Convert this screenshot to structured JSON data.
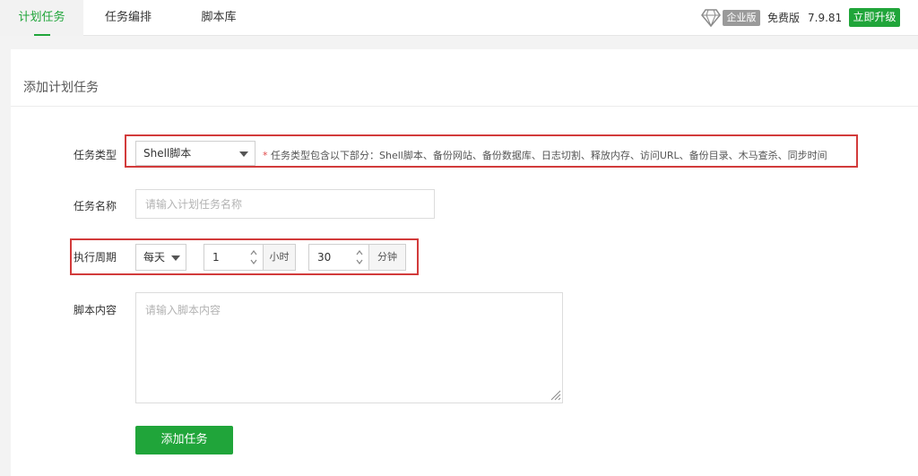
{
  "nav": {
    "tabs": [
      {
        "label": "计划任务",
        "active": true
      },
      {
        "label": "任务编排",
        "active": false
      },
      {
        "label": "脚本库",
        "active": false
      }
    ],
    "edition_badge": "企业版",
    "free_label": "免费版",
    "version": "7.9.81",
    "upgrade_label": "立即升级"
  },
  "panel": {
    "title": "添加计划任务"
  },
  "form": {
    "task_type": {
      "label": "任务类型",
      "selected": "Shell脚本",
      "hint_star": "*",
      "hint": "任务类型包含以下部分：Shell脚本、备份网站、备份数据库、日志切割、释放内存、访问URL、备份目录、木马查杀、同步时间"
    },
    "task_name": {
      "label": "任务名称",
      "placeholder": "请输入计划任务名称"
    },
    "period": {
      "label": "执行周期",
      "cycle": "每天",
      "hour_value": "1",
      "hour_unit": "小时",
      "minute_value": "30",
      "minute_unit": "分钟"
    },
    "script": {
      "label": "脚本内容",
      "placeholder": "请输入脚本内容"
    },
    "submit_label": "添加任务"
  },
  "colors": {
    "accent": "#20a53a",
    "highlight": "#d23b3b"
  }
}
